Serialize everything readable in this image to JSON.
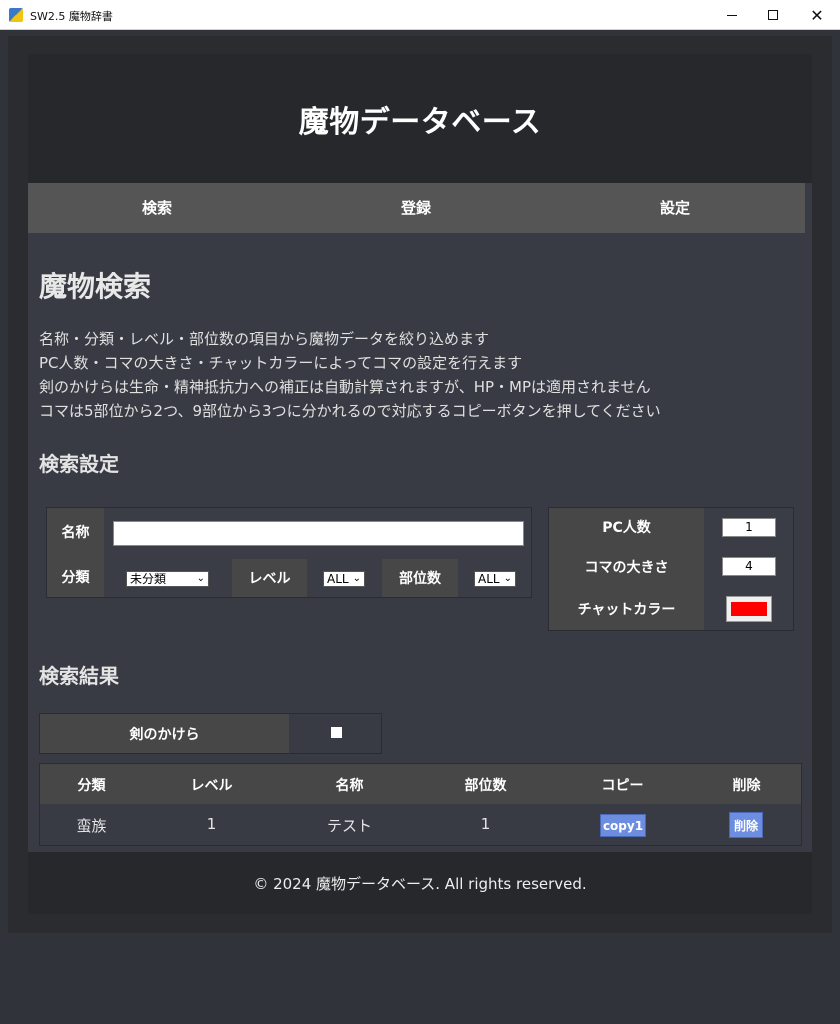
{
  "window": {
    "title": "SW2.5 魔物辞書",
    "minimize": "—",
    "close": "✕"
  },
  "header": {
    "title": "魔物データベース"
  },
  "nav": {
    "items": [
      {
        "label": "検索"
      },
      {
        "label": "登録"
      },
      {
        "label": "設定"
      }
    ]
  },
  "main": {
    "page_title": "魔物検索",
    "description": [
      "名称・分類・レベル・部位数の項目から魔物データを絞り込めます",
      "PC人数・コマの大きさ・チャットカラーによってコマの設定を行えます",
      "剣のかけらは生命・精神抵抗力への補正は自動計算されますが、HP・MPは適用されません",
      "コマは5部位から2つ、9部位から3つに分かれるので対応するコピーボタンを押してください"
    ],
    "search_settings_title": "検索設定",
    "results_title": "検索結果"
  },
  "search_form": {
    "name_label": "名称",
    "name_value": "",
    "category_label": "分類",
    "category_value": "未分類",
    "level_label": "レベル",
    "level_value": "ALL",
    "parts_label": "部位数",
    "parts_value": "ALL"
  },
  "pc_settings": {
    "pc_count_label": "PC人数",
    "pc_count_value": "1",
    "piece_size_label": "コマの大きさ",
    "piece_size_value": "4",
    "chat_color_label": "チャットカラー",
    "chat_color_value": "#ff0000"
  },
  "shard": {
    "label": "剣のかけら",
    "checked": true
  },
  "results": {
    "headers": [
      "分類",
      "レベル",
      "名称",
      "部位数",
      "コピー",
      "削除"
    ],
    "rows": [
      {
        "category": "蛮族",
        "level": "1",
        "name": "テスト",
        "parts": "1",
        "copy_label": "copy1",
        "delete_label": "削除"
      }
    ]
  },
  "footer": {
    "text": "© 2024 魔物データベース. All rights reserved."
  },
  "colors": {
    "accent_button": "#6d8ee0",
    "header_bg": "#27282c",
    "nav_bg": "#555555",
    "label_bg": "#474747"
  }
}
